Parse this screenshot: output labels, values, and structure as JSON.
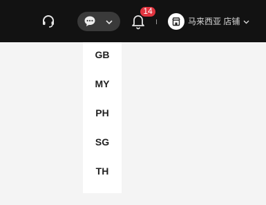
{
  "header": {
    "notification_count": "14",
    "store_name": "马来西亚 店铺"
  },
  "icons": {
    "support": "headset-icon",
    "chat": "chat-bubble-icon",
    "notifications": "bell-icon",
    "store": "store-icon",
    "chevron": "chevron-down-icon"
  },
  "colors": {
    "topbar_bg": "#121212",
    "badge": "#e0343f",
    "page_bg": "#f4f4f4"
  },
  "dropdown": {
    "items": [
      "GB",
      "MY",
      "PH",
      "SG",
      "TH"
    ]
  }
}
